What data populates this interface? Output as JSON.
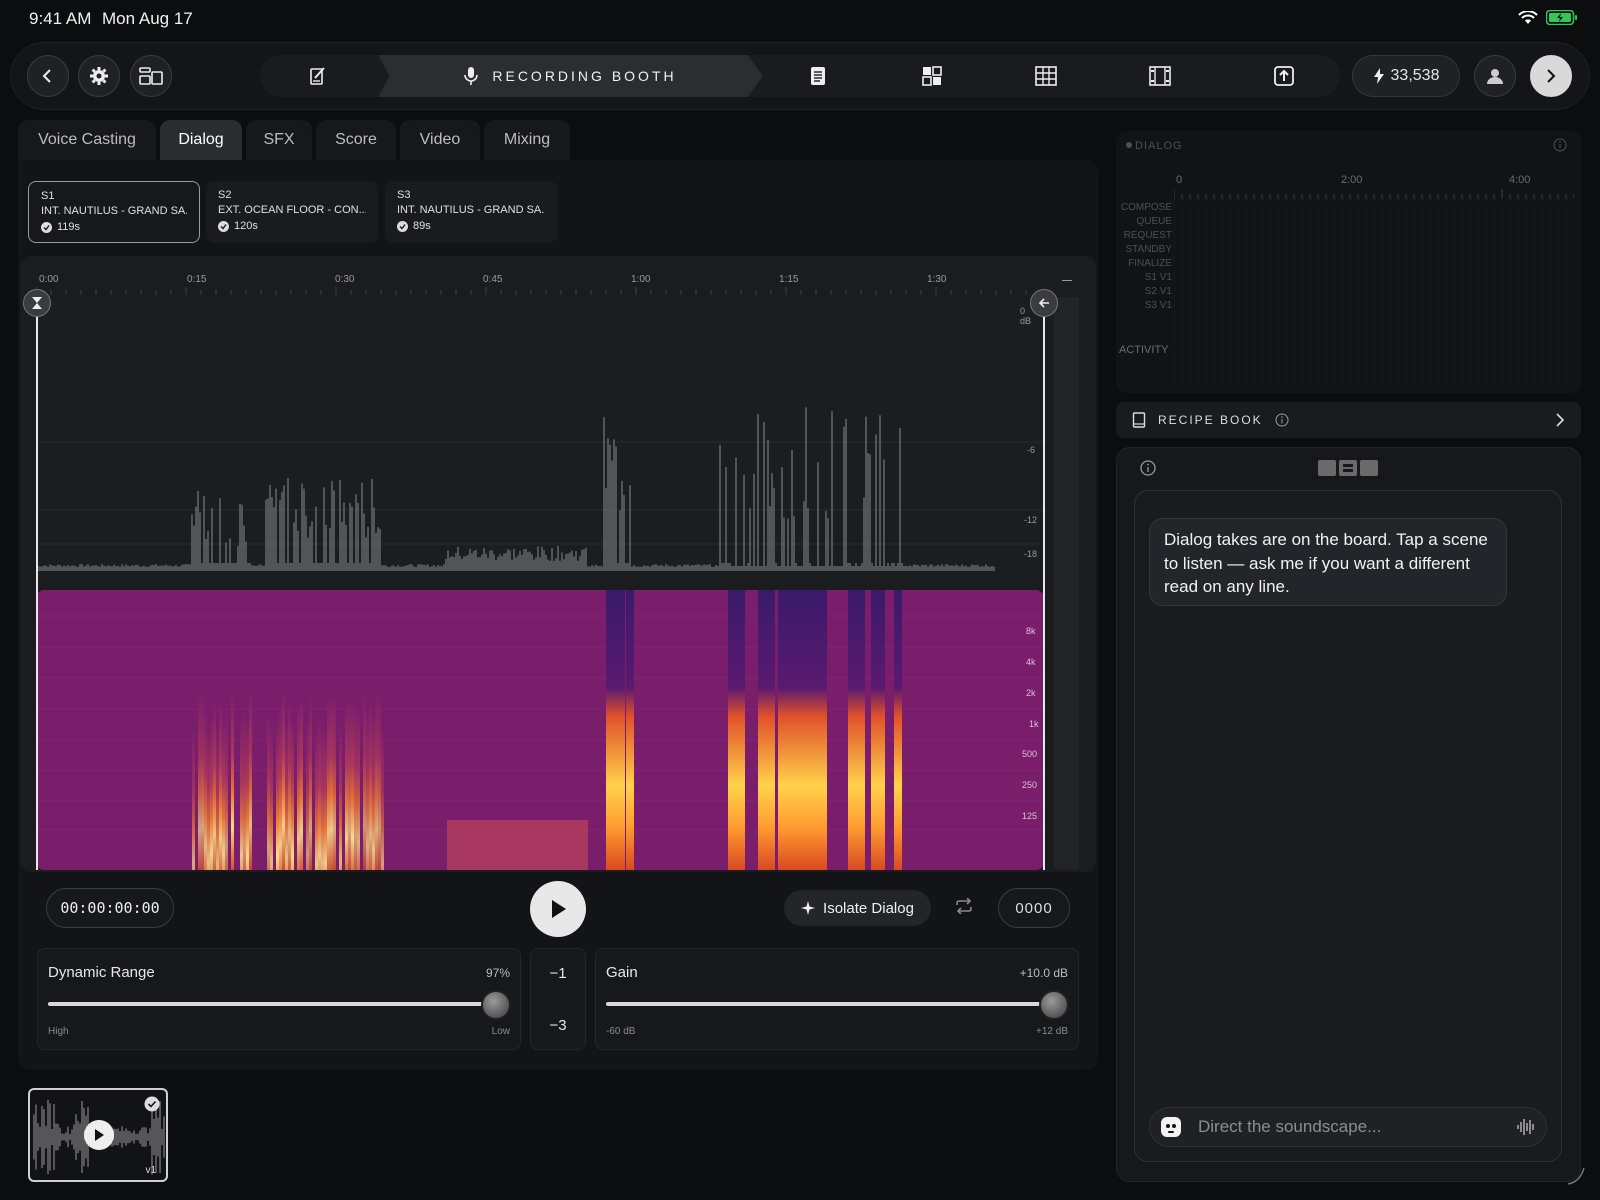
{
  "status": {
    "time": "9:41 AM",
    "date": "Mon Aug 17"
  },
  "topbar": {
    "active_stage": "RECORDING BOOTH",
    "credits": "33,538",
    "stages": [
      "script-icon",
      "microphone-icon",
      "document-icon",
      "storyboard-icon",
      "grid-icon",
      "film-icon",
      "export-icon"
    ]
  },
  "tabs": [
    "Voice Casting",
    "Dialog",
    "SFX",
    "Score",
    "Video",
    "Mixing"
  ],
  "active_tab": "Dialog",
  "scenes": [
    {
      "id": "S1",
      "title": "INT. NAUTILUS - GRAND SA...",
      "duration": "119s"
    },
    {
      "id": "S2",
      "title": "EXT. OCEAN FLOOR - CON...",
      "duration": "120s"
    },
    {
      "id": "S3",
      "title": "INT. NAUTILUS - GRAND SA...",
      "duration": "89s"
    }
  ],
  "ruler": [
    "0:00",
    "0:15",
    "0:30",
    "0:45",
    "1:00",
    "1:15",
    "1:30"
  ],
  "db_scale": [
    "0 dB",
    "-6",
    "-12",
    "-18"
  ],
  "hz_scale": [
    "8k",
    "4k",
    "2k",
    "1k",
    "500",
    "250",
    "125"
  ],
  "transport": {
    "timecode": "00:00:00:00",
    "isolate_label": "Isolate Dialog",
    "counter": "0000"
  },
  "dynamic_range": {
    "title": "Dynamic Range",
    "value": "97%",
    "min_label": "High",
    "max_label": "Low",
    "level": 0.97
  },
  "steps": [
    "−1",
    "−3"
  ],
  "gain": {
    "title": "Gain",
    "value": "+10.0 dB",
    "min_label": "-60 dB",
    "max_label": "+12 dB",
    "level": 0.97
  },
  "version_label": "v1",
  "dialog_panel": {
    "title": "DIALOG",
    "time_ticks": [
      "0",
      "2:00",
      "4:00"
    ],
    "rows": [
      "COMPOSE",
      "QUEUE",
      "REQUEST",
      "STANDBY",
      "FINALIZE",
      "S1 V1",
      "S2 V1",
      "S3 V1"
    ],
    "activity_label": "ACTIVITY"
  },
  "recipe_book": "RECIPE BOOK",
  "chat": {
    "message": "Dialog takes are on the board. Tap a scene to listen — ask me if you want a different read on any line.",
    "placeholder": "Direct the soundscape..."
  },
  "colors": {
    "spectrogram_bg": "#7a1e6c",
    "spectrogram_hot": "#ffd24a",
    "battery": "#34c759"
  }
}
